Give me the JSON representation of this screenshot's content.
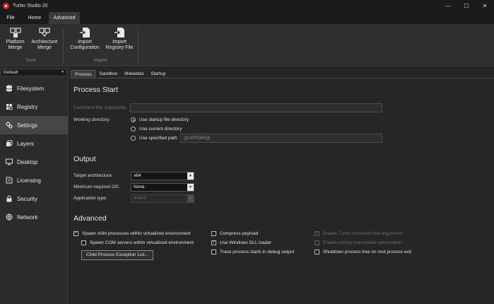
{
  "app": {
    "title": "Turbo Studio 20"
  },
  "window_controls": {
    "minimize": "—",
    "maximize": "☐",
    "close": "✕"
  },
  "menu": {
    "tabs": [
      {
        "label": "File"
      },
      {
        "label": "Home"
      },
      {
        "label": "Advanced",
        "active": true
      }
    ]
  },
  "ribbon": {
    "tools_buttons": [
      {
        "line1": "Platform",
        "line2": "Merge",
        "icon": "platform-merge-icon"
      },
      {
        "line1": "Architecture",
        "line2": "Merge",
        "icon": "architecture-merge-icon"
      }
    ],
    "import_buttons": [
      {
        "line1": "Import",
        "line2": "Configuration",
        "icon": "import-configuration-icon"
      },
      {
        "line1": "Import",
        "line2": "Registry File",
        "icon": "import-registry-icon"
      }
    ],
    "groups": {
      "tools": "Tools",
      "import": "Import"
    }
  },
  "sidebar": {
    "profile_dropdown": "Default",
    "items": [
      {
        "label": "Filesystem",
        "icon": "filesystem-icon"
      },
      {
        "label": "Registry",
        "icon": "registry-icon"
      },
      {
        "label": "Settings",
        "icon": "settings-icon",
        "active": true
      },
      {
        "label": "Layers",
        "icon": "layers-icon"
      },
      {
        "label": "Desktop",
        "icon": "desktop-icon"
      },
      {
        "label": "Licensing",
        "icon": "licensing-icon"
      },
      {
        "label": "Security",
        "icon": "security-icon"
      },
      {
        "label": "Network",
        "icon": "network-icon"
      }
    ]
  },
  "tabs": [
    {
      "label": "Process",
      "active": true
    },
    {
      "label": "Sandbox"
    },
    {
      "label": "Metadata"
    },
    {
      "label": "Startup"
    }
  ],
  "process_start": {
    "title": "Process Start",
    "command_line_label": "Command line arguments:",
    "command_line_value": "",
    "working_directory_label": "Working directory:",
    "options": [
      {
        "label": "Use startup file directory",
        "checked": true
      },
      {
        "label": "Use current directory",
        "checked": false
      },
      {
        "label": "Use specified path:",
        "checked": false
      }
    ],
    "specified_path_placeholder": "@APPDIR@"
  },
  "output": {
    "title": "Output",
    "target_arch_label": "Target architecture:",
    "target_arch_value": "x64",
    "min_os_label": "Minimum required OS:",
    "min_os_value": "None",
    "app_type_label": "Application type:",
    "app_type_value": "Inherit"
  },
  "advanced": {
    "title": "Advanced",
    "col1": [
      {
        "label": "Spawn child processes within virtualized environment",
        "checked": true,
        "disabled": false
      },
      {
        "label": "Spawn COM servers within virtualized environment",
        "checked": false,
        "disabled": false
      }
    ],
    "button": "Child Process Exception List...",
    "col2": [
      {
        "label": "Compress payload",
        "checked": false,
        "disabled": false
      },
      {
        "label": "Use Windows DLL loader",
        "checked": true,
        "disabled": false
      },
      {
        "label": "Trace process starts in debug output",
        "checked": false,
        "disabled": false
      }
    ],
    "col3": [
      {
        "label": "Enable Turbo command line arguments",
        "checked": true,
        "disabled": true
      },
      {
        "label": "Enable startup executable optimization",
        "checked": false,
        "disabled": true
      },
      {
        "label": "Shutdown process tree on root process exit",
        "checked": false,
        "disabled": false
      }
    ]
  },
  "colors": {
    "accent_red": "#d8262c",
    "background": "#262626",
    "sidebar": "#2b2b2b",
    "ribbon": "#2f2f2f"
  }
}
